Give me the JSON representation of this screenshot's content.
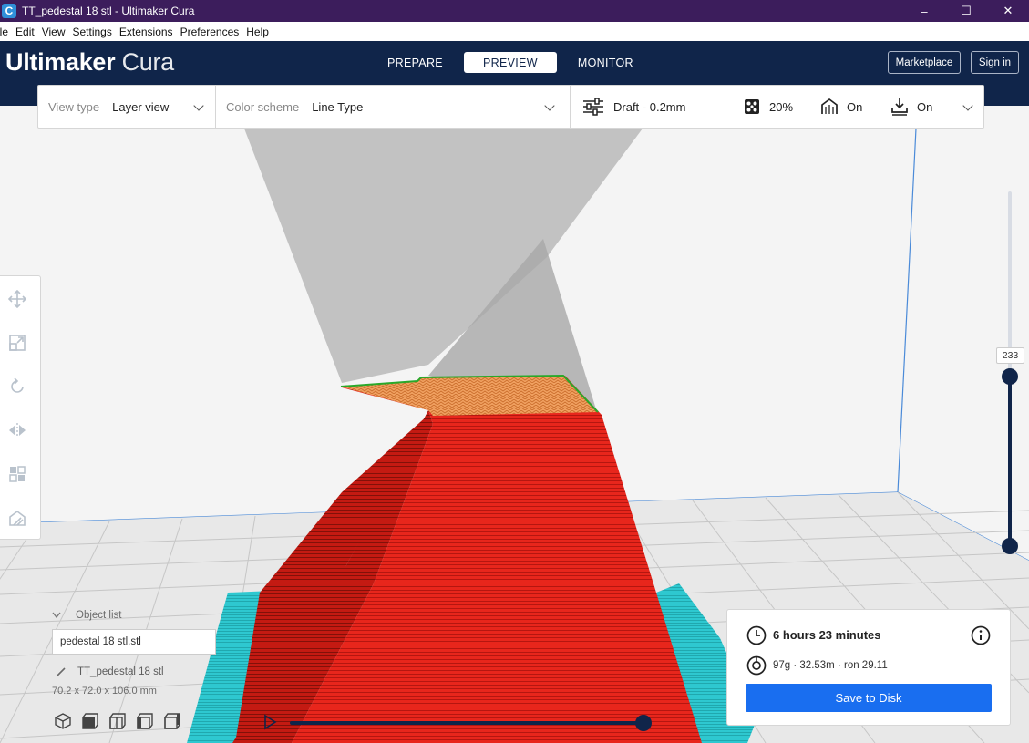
{
  "window": {
    "title": "TT_pedestal 18 stl - Ultimaker Cura",
    "app_icon": "C",
    "minimize": "–",
    "maximize": "☐",
    "close": "✕"
  },
  "menu": [
    "ile",
    "Edit",
    "View",
    "Settings",
    "Extensions",
    "Preferences",
    "Help"
  ],
  "header": {
    "logo_light": "Ultimaker",
    "logo_bold": "Cura",
    "tabs": [
      {
        "label": "PREPARE",
        "active": false
      },
      {
        "label": "PREVIEW",
        "active": true
      },
      {
        "label": "MONITOR",
        "active": false
      }
    ],
    "marketplace_label": "Marketplace",
    "signin_label": "Sign in"
  },
  "settings_bar": {
    "view_type_label": "View type",
    "view_type_value": "Layer view",
    "color_scheme_label": "Color scheme",
    "color_scheme_value": "Line Type",
    "profile": "Draft - 0.2mm",
    "infill": "20%",
    "support": "On",
    "adhesion": "On"
  },
  "layer_slider": {
    "current_layer": "233"
  },
  "object_list": {
    "header": "Object list",
    "field_value": "pedestal 18 stl.stl",
    "item_name": "TT_pedestal 18 stl",
    "dimensions": "70.2 x 72.0 x 106.0 mm"
  },
  "print_info": {
    "time": "6 hours 23 minutes",
    "material": "97g · 32.53m · ron 29.11",
    "save_label": "Save to Disk"
  },
  "colors": {
    "header_bg": "#10254a",
    "title_bg": "#3c1d5c",
    "accent": "#196ef0",
    "model_wall": "#e8261c",
    "model_infill": "#f0a060",
    "skirt": "#2ec8d0",
    "shadow": "#bdbdbd"
  }
}
